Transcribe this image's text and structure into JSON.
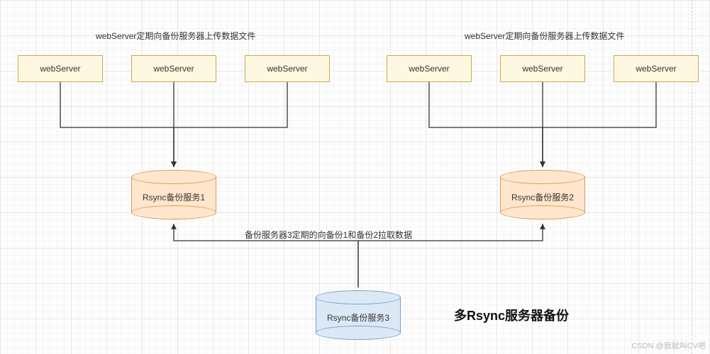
{
  "captions": {
    "left": "webServer定期向备份服务器上传数据文件",
    "right": "webServer定期向备份服务器上传数据文件",
    "middle": "备份服务器3定期的向备份1和备份2拉取数据"
  },
  "webservers": {
    "g1": [
      "webServer",
      "webServer",
      "webServer"
    ],
    "g2": [
      "webServer",
      "webServer",
      "webServer"
    ]
  },
  "backups": {
    "b1": "Rsync备份服务1",
    "b2": "Rsync备份服务2",
    "b3": "Rsync备份服务3"
  },
  "title": "多Rsync服务器备份",
  "watermark": "CSDN @我就叫CV吧",
  "chart_data": {
    "type": "diagram",
    "title": "多Rsync服务器备份",
    "nodes": [
      {
        "id": "ws1",
        "type": "webServer",
        "label": "webServer",
        "group": 1
      },
      {
        "id": "ws2",
        "type": "webServer",
        "label": "webServer",
        "group": 1
      },
      {
        "id": "ws3",
        "type": "webServer",
        "label": "webServer",
        "group": 1
      },
      {
        "id": "ws4",
        "type": "webServer",
        "label": "webServer",
        "group": 2
      },
      {
        "id": "ws5",
        "type": "webServer",
        "label": "webServer",
        "group": 2
      },
      {
        "id": "ws6",
        "type": "webServer",
        "label": "webServer",
        "group": 2
      },
      {
        "id": "b1",
        "type": "rsyncBackup",
        "label": "Rsync备份服务1"
      },
      {
        "id": "b2",
        "type": "rsyncBackup",
        "label": "Rsync备份服务2"
      },
      {
        "id": "b3",
        "type": "rsyncBackup",
        "label": "Rsync备份服务3"
      }
    ],
    "edges": [
      {
        "from": "ws1",
        "to": "b1",
        "label": "webServer定期向备份服务器上传数据文件"
      },
      {
        "from": "ws2",
        "to": "b1"
      },
      {
        "from": "ws3",
        "to": "b1"
      },
      {
        "from": "ws4",
        "to": "b2",
        "label": "webServer定期向备份服务器上传数据文件"
      },
      {
        "from": "ws5",
        "to": "b2"
      },
      {
        "from": "ws6",
        "to": "b2"
      },
      {
        "from": "b3",
        "to": "b1",
        "label": "备份服务器3定期的向备份1和备份2拉取数据"
      },
      {
        "from": "b3",
        "to": "b2"
      }
    ]
  }
}
